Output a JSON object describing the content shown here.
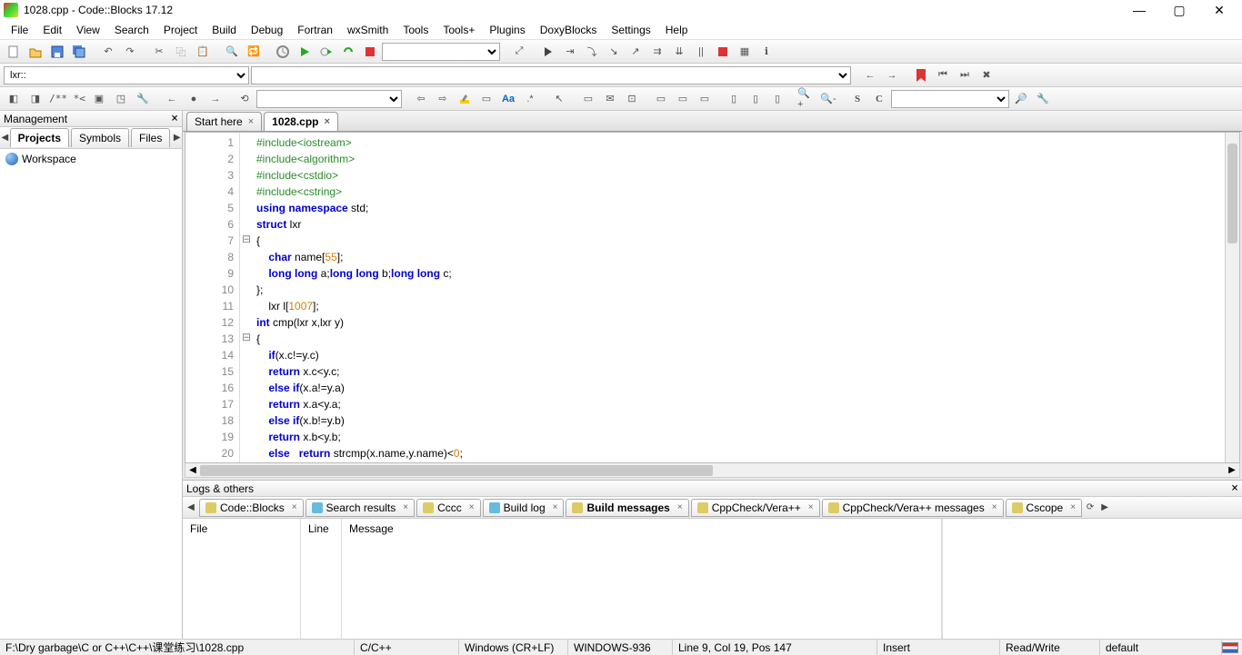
{
  "window": {
    "title": "1028.cpp - Code::Blocks 17.12"
  },
  "menu": [
    "File",
    "Edit",
    "View",
    "Search",
    "Project",
    "Build",
    "Debug",
    "Fortran",
    "wxSmith",
    "Tools",
    "Tools+",
    "Plugins",
    "DoxyBlocks",
    "Settings",
    "Help"
  ],
  "scope_combo": "lxr::",
  "management": {
    "title": "Management",
    "tabs": [
      "Projects",
      "Symbols",
      "Files"
    ],
    "active_tab": 0,
    "workspace": "Workspace"
  },
  "editor_tabs": [
    {
      "label": "Start here",
      "active": false
    },
    {
      "label": "1028.cpp",
      "active": true
    }
  ],
  "code": {
    "line_count": 20,
    "lines": [
      {
        "n": 1,
        "html": "<span class='c-pre'>#include&lt;iostream&gt;</span>"
      },
      {
        "n": 2,
        "html": "<span class='c-pre'>#include&lt;algorithm&gt;</span>"
      },
      {
        "n": 3,
        "html": "<span class='c-pre'>#include&lt;cstdio&gt;</span>"
      },
      {
        "n": 4,
        "html": "<span class='c-pre'>#include&lt;cstring&gt;</span>"
      },
      {
        "n": 5,
        "html": "<span class='c-kw'>using</span> <span class='c-kw'>namespace</span> std;"
      },
      {
        "n": 6,
        "html": "<span class='c-kw'>struct</span> lxr"
      },
      {
        "n": 7,
        "html": "{",
        "fold": "⊟"
      },
      {
        "n": 8,
        "html": "    <span class='c-kw'>char</span> name[<span class='c-num'>55</span>];"
      },
      {
        "n": 9,
        "html": "    <span class='c-kw'>long</span> <span class='c-kw'>long</span> a;<span class='c-kw'>long</span> <span class='c-kw'>long</span> b;<span class='c-kw'>long</span> <span class='c-kw'>long</span> c;"
      },
      {
        "n": 10,
        "html": "};"
      },
      {
        "n": 11,
        "html": "    lxr l[<span class='c-num'>1007</span>];"
      },
      {
        "n": 12,
        "html": "<span class='c-kw'>int</span> cmp(lxr x,lxr y)"
      },
      {
        "n": 13,
        "html": "{",
        "fold": "⊟"
      },
      {
        "n": 14,
        "html": "    <span class='c-kw'>if</span>(x.c!=y.c)"
      },
      {
        "n": 15,
        "html": "    <span class='c-kw'>return</span> x.c&lt;y.c;"
      },
      {
        "n": 16,
        "html": "    <span class='c-kw'>else</span> <span class='c-kw'>if</span>(x.a!=y.a)"
      },
      {
        "n": 17,
        "html": "    <span class='c-kw'>return</span> x.a&lt;y.a;"
      },
      {
        "n": 18,
        "html": "    <span class='c-kw'>else</span> <span class='c-kw'>if</span>(x.b!=y.b)"
      },
      {
        "n": 19,
        "html": "    <span class='c-kw'>return</span> x.b&lt;y.b;"
      },
      {
        "n": 20,
        "html": "    <span class='c-kw'>else</span>   <span class='c-kw'>return</span> strcmp(x.name,y.name)&lt;<span class='c-num'>0</span>;"
      }
    ]
  },
  "logs": {
    "title": "Logs & others",
    "tabs": [
      "Code::Blocks",
      "Search results",
      "Cccc",
      "Build log",
      "Build messages",
      "CppCheck/Vera++",
      "CppCheck/Vera++ messages",
      "Cscope"
    ],
    "active_tab": 4,
    "headers": {
      "file": "File",
      "line": "Line",
      "message": "Message"
    }
  },
  "status": {
    "path": "F:\\Dry garbage\\C or C++\\C++\\课堂练习\\1028.cpp",
    "lang": "C/C++",
    "eol": "Windows (CR+LF)",
    "encoding": "WINDOWS-936",
    "position": "Line 9, Col 19, Pos 147",
    "insert": "Insert",
    "rw": "Read/Write",
    "profile": "default"
  }
}
